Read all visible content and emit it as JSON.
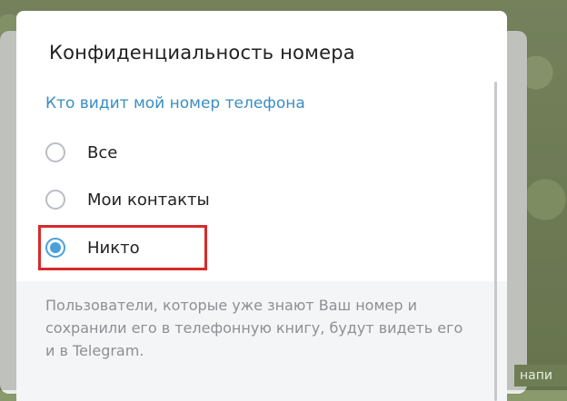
{
  "dialog": {
    "title": "Конфиденциальность номера",
    "section_title": "Кто видит мой номер телефона",
    "options": [
      {
        "label": "Все",
        "checked": false
      },
      {
        "label": "Мои контакты",
        "checked": false
      },
      {
        "label": "Никто",
        "checked": true
      }
    ],
    "description": "Пользователи, которые уже знают Ваш номер и сохранили его в телефонную книгу, будут видеть его и в Telegram."
  },
  "background": {
    "hint_text": "напи"
  },
  "colors": {
    "accent": "#4aa0dc",
    "section_title": "#3a8ec3",
    "highlight": "#d72a2a"
  }
}
